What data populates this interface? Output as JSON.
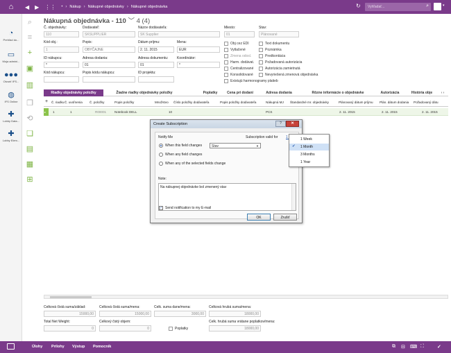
{
  "topbar": {
    "breadcrumb": [
      "Nákup",
      "Nákupné objednávky",
      "Nákupné objednávka"
    ],
    "search_placeholder": "Vyhľadať...",
    "accent": "#7a3a8a"
  },
  "rail": [
    {
      "label": "Prehľad do...",
      "icon": "gauge-icon"
    },
    {
      "label": "Moja admini...",
      "icon": "monitor-icon"
    },
    {
      "label": "Otvoriť IFS...",
      "icon": "people-icon"
    },
    {
      "label": "IFS Online",
      "icon": "globe-icon"
    },
    {
      "label": "Lobby Data...",
      "icon": "puzzle-icon"
    },
    {
      "label": "Lobby Elem...",
      "icon": "puzzle-icon"
    }
  ],
  "header": {
    "title": "Nákupná objednávka - 110",
    "count": "4 (4)"
  },
  "form": {
    "order_no_label": "Č. objednávky:",
    "order_no": "110",
    "supplier_label": "Dodávateľ:",
    "supplier": "SKSUPPLIER",
    "supplier_name_label": "Názov dodávateľa:",
    "supplier_name": "SK Supplier",
    "site_label": "Miesto:",
    "site": "01",
    "status_label": "Stav:",
    "status": "Plánované",
    "code_label": "Kód obj.:",
    "code": "1",
    "desc_label": "Popis:",
    "desc": "OBYČAJNE",
    "receipt_date_label": "Dátum príjmu:",
    "receipt_date": "2. 11. 2015",
    "currency_label": "Mena:",
    "currency": "EUR",
    "buyer_label": "ID nákupcu:",
    "buyer": "*",
    "delivery_addr_label": "Adresa dodania:",
    "delivery_addr": "01",
    "doc_addr_label": "Adresa dokumentu:",
    "doc_addr": "01",
    "coordinator_label": "Koordinátor:",
    "coordinator": "*",
    "buyer_code_label": "Kód nákupcu:",
    "buyer_code_desc_label": "Popis kódu nákupcu:",
    "project_label": "ID projektu:",
    "checks_col1": [
      "Obj cez EDI",
      "Vytlačené",
      "Zmena odosl.",
      "Harm. dodávat.",
      "Centralizované",
      "Konsolidované",
      "Existujú harmonogramy platieb"
    ],
    "checks_col2": [
      "Text dokumentu",
      "Poznámka",
      "Predkontácia",
      "Požadovaná autorizácia",
      "Autorizácia zamietnutá",
      "Nevyriešená zmenová objednávka"
    ]
  },
  "tabs": [
    "Riadky objednávky položky",
    "Žiadne riadky objednávky položky",
    "Poplatky",
    "Cena pri dodaní",
    "Adresa dodania",
    "Rôzne informácie o objednávke",
    "Autorizácia",
    "História obje"
  ],
  "grid": {
    "headers": [
      "Č. riadku",
      "Č. uvoľnenia",
      "Č. položky",
      "Popis položky",
      "Množstvo",
      "Číslo položky dodávateľa",
      "Popis položky dodávateľa",
      "Nákupná MJ",
      "Štandardné mr. objednávky",
      "Plánovaný dátum príjmu",
      "Plán. dátum dodania",
      "Požadovaný dátu"
    ],
    "row": [
      "1",
      "1",
      "R00001",
      "Notebook DELL",
      "10",
      "",
      "",
      "PCS",
      "",
      "2. 11. 2015",
      "2. 11. 2015",
      "2. 11. 2015"
    ]
  },
  "totals": {
    "net_label": "Celková čistá suma/základ:",
    "net": "15000,00",
    "net_cur_label": "Celková čistá suma/mena:",
    "net_cur": "15000,00",
    "tax_label": "Celk. suma dane/mena:",
    "tax": "3000,00",
    "gross_cur_label": "Celková hrubá suma/mena:",
    "gross_cur": "18000,00",
    "weight_label": "Total Net Weight:",
    "weight": "0",
    "volume_label": "Celkový čistý objem:",
    "volume": "0",
    "charges_label": "Poplatky",
    "gross_incl_label": "Celk. hrubá suma vrátane poplatkov/mena:",
    "gross_incl": "18000,00"
  },
  "bottombar": [
    "Úlohy",
    "Prílohy",
    "Výstup",
    "Pomocník"
  ],
  "dialog": {
    "title": "Create Subscription",
    "help": "?",
    "close": "✕",
    "notify_me": "Notify Me",
    "valid_for_label": "Subscription valid for",
    "valid_for_value": "1 M",
    "options": [
      "When this field changes",
      "When any field changes",
      "When any of the selected fields change"
    ],
    "field_value": "Stav",
    "note_label": "Note:",
    "note": "Na nákupnej objednávke bol zmenený stav",
    "send_email": "Send notification to my E-mail",
    "ok": "OK",
    "cancel": "Zrušiť"
  },
  "valid_for_popup": {
    "items": [
      "1 Week",
      "1 Month",
      "3 Months",
      "1 Year"
    ],
    "selected": "1 Month"
  }
}
